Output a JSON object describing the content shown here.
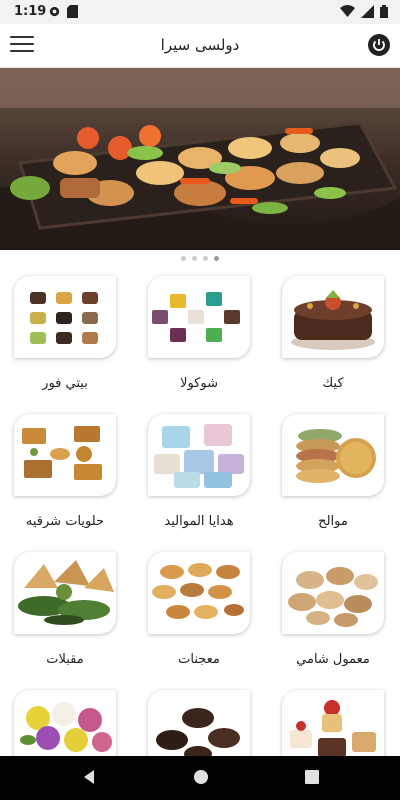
{
  "status_bar": {
    "time": "1:19"
  },
  "app_bar": {
    "title": "دولسى سيرا"
  },
  "banner": {
    "slide_count": 4,
    "active_slide": 4
  },
  "categories": [
    {
      "label": "بيتي فور"
    },
    {
      "label": "شوكولا"
    },
    {
      "label": "كيك"
    },
    {
      "label": "حلويات شرقيه"
    },
    {
      "label": "هدايا المواليد"
    },
    {
      "label": "موالح"
    },
    {
      "label": "مقبلات"
    },
    {
      "label": "معجنات"
    },
    {
      "label": "معمول شامي"
    }
  ],
  "colors": {
    "accent": "#222222",
    "background": "#ffffff",
    "navbar": "#000000"
  }
}
